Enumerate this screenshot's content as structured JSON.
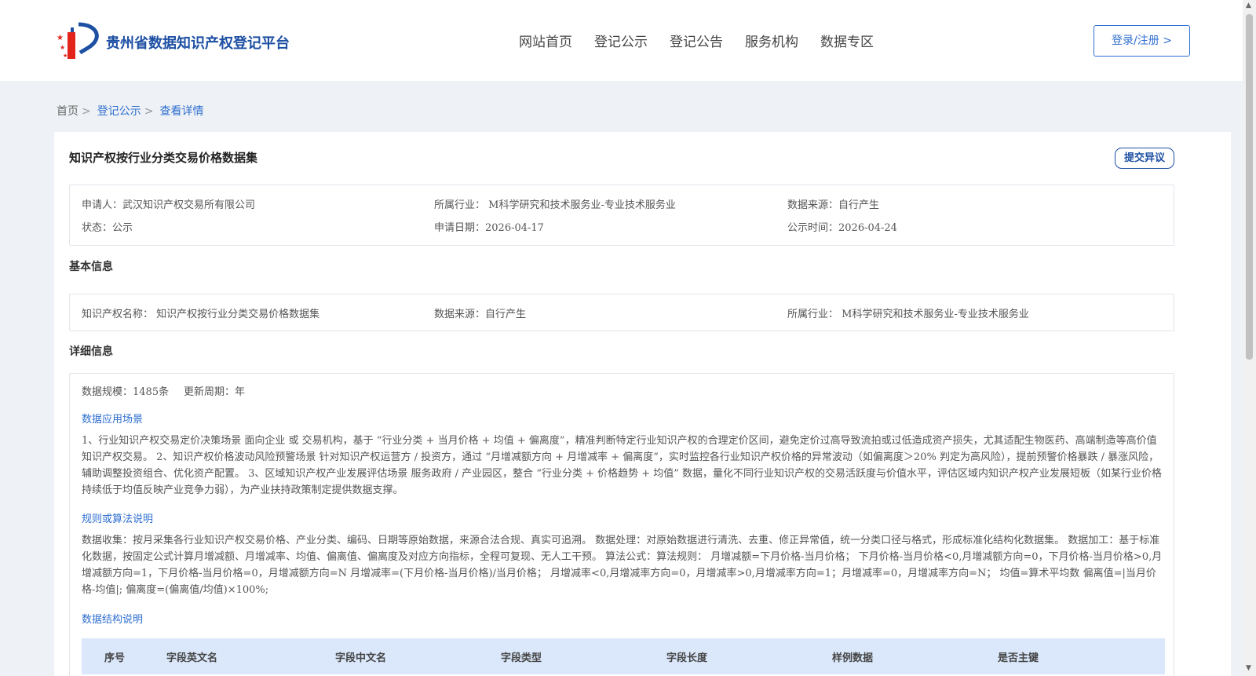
{
  "header": {
    "site_title": "贵州省数据知识产权登记平台",
    "nav": [
      "网站首页",
      "登记公示",
      "登记公告",
      "服务机构",
      "数据专区"
    ],
    "login_label": "登录/注册 >"
  },
  "breadcrumb": {
    "home": "首页",
    "sep": ">",
    "level1": "登记公示",
    "current": "查看详情"
  },
  "detail": {
    "title": "知识产权按行业分类交易价格数据集",
    "objection_label": "提交异议",
    "summary": {
      "applicant": "申请人：武汉知识产权交易所有限公司",
      "industry": "所属行业： M科学研究和技术服务业-专业技术服务业",
      "source": "数据来源：自行产生",
      "status": "状态：公示",
      "apply_date": "申请日期：2026-04-17",
      "publish_date": "公示时间：2026-04-24"
    },
    "basic_title": "基本信息",
    "basic": {
      "name": "知识产权名称： 知识产权按行业分类交易价格数据集",
      "source": "数据来源：自行产生",
      "industry": "所属行业： M科学研究和技术服务业-专业技术服务业"
    },
    "detail_title": "详细信息",
    "scale": "数据规模：1485条",
    "cycle": "更新周期：年",
    "scene_title": "数据应用场景",
    "scene_text": "1、行业知识产权交易定价决策场景 面向企业 或 交易机构，基于 “行业分类 + 当月价格 + 均值 + 偏离度”，精准判断特定行业知识产权的合理定价区间，避免定价过高导致流拍或过低造成资产损失，尤其适配生物医药、高端制造等高价值知识产权交易。 2、知识产权价格波动风险预警场景 针对知识产权运营方 / 投资方，通过 “月增减额方向 + 月增减率 + 偏离度”，实时监控各行业知识产权价格的异常波动（如偏离度＞20% 判定为高风险），提前预警价格暴跌 / 暴涨风险，辅助调整投资组合、优化资产配置。 3、区域知识产权产业发展评估场景 服务政府 / 产业园区，整合 “行业分类 + 价格趋势 + 均值” 数据，量化不同行业知识产权的交易活跃度与价值水平，评估区域内知识产权产业发展短板（如某行业价格持续低于均值反映产业竞争力弱），为产业扶持政策制定提供数据支撑。",
    "algo_title": "规则或算法说明",
    "algo_text": "数据收集：按月采集各行业知识产权交易价格、产业分类、编码、日期等原始数据，来源合法合规、真实可追溯。 数据处理：对原始数据进行清洗、去重、修正异常值，统一分类口径与格式，形成标准化结构化数据集。 数据加工：基于标准化数据，按固定公式计算月增减额、月增减率、均值、偏离值、偏离度及对应方向指标，全程可复现、无人工干预。 算法公式：算法规则： 月增减额=下月价格-当月价格； 下月价格-当月价格<0,月增减额方向=0，下月价格-当月价格>0,月增减额方向=1，下月价格-当月价格=0，月增减额方向=N 月增减率=(下月价格-当月价格)/当月价格； 月增减率<0,月增减率方向=0，月增减率>0,月增减率方向=1；月增减率=0，月增减率方向=N； 均值=算术平均数 偏离值=|当月价格-均值|; 偏离度=(偏离值/均值)×100%;",
    "structure_title": "数据结构说明",
    "table_headers": [
      "序号",
      "字段英文名",
      "字段中文名",
      "字段类型",
      "字段长度",
      "样例数据",
      "是否主键"
    ]
  },
  "colors": {
    "brand": "#1d4fa3",
    "link": "#2f6fd0",
    "table_head_bg": "#dbe8fb",
    "page_bg": "#eef1f5"
  }
}
